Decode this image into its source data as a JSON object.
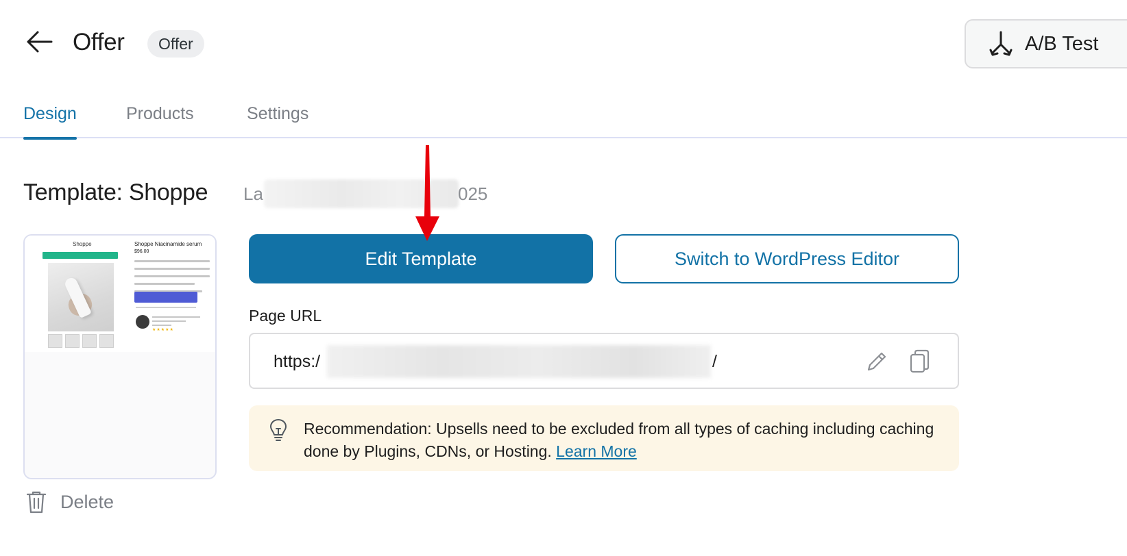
{
  "header": {
    "title": "Offer",
    "badge": "Offer",
    "ab_test_label": "A/B Test"
  },
  "tabs": [
    {
      "label": "Design",
      "active": true
    },
    {
      "label": "Products",
      "active": false
    },
    {
      "label": "Settings",
      "active": false
    }
  ],
  "template": {
    "title": "Template: Shoppe",
    "meta_start": "La",
    "meta_end": "025",
    "thumbnail": {
      "brand": "Shoppe",
      "product_title": "Shoppe Niacinamide serum",
      "price": "$96.00",
      "stars": "★★★★★"
    },
    "delete_label": "Delete"
  },
  "actions": {
    "edit_label": "Edit Template",
    "switch_label": "Switch to WordPress Editor"
  },
  "page_url": {
    "label": "Page URL",
    "value_start": "https:/",
    "value_end": "/"
  },
  "notice": {
    "text": "Recommendation: Upsells need to be excluded from all types of caching including caching done by Plugins, CDNs, or Hosting.",
    "link": "Learn More"
  },
  "colors": {
    "accent": "#1272a6",
    "annotation_arrow": "#e8000b",
    "notice_bg": "#fdf6e6"
  },
  "icons": [
    "arrow-left-icon",
    "ab-split-icon",
    "lightbulb-icon",
    "pencil-icon",
    "copy-icon",
    "trash-icon"
  ]
}
